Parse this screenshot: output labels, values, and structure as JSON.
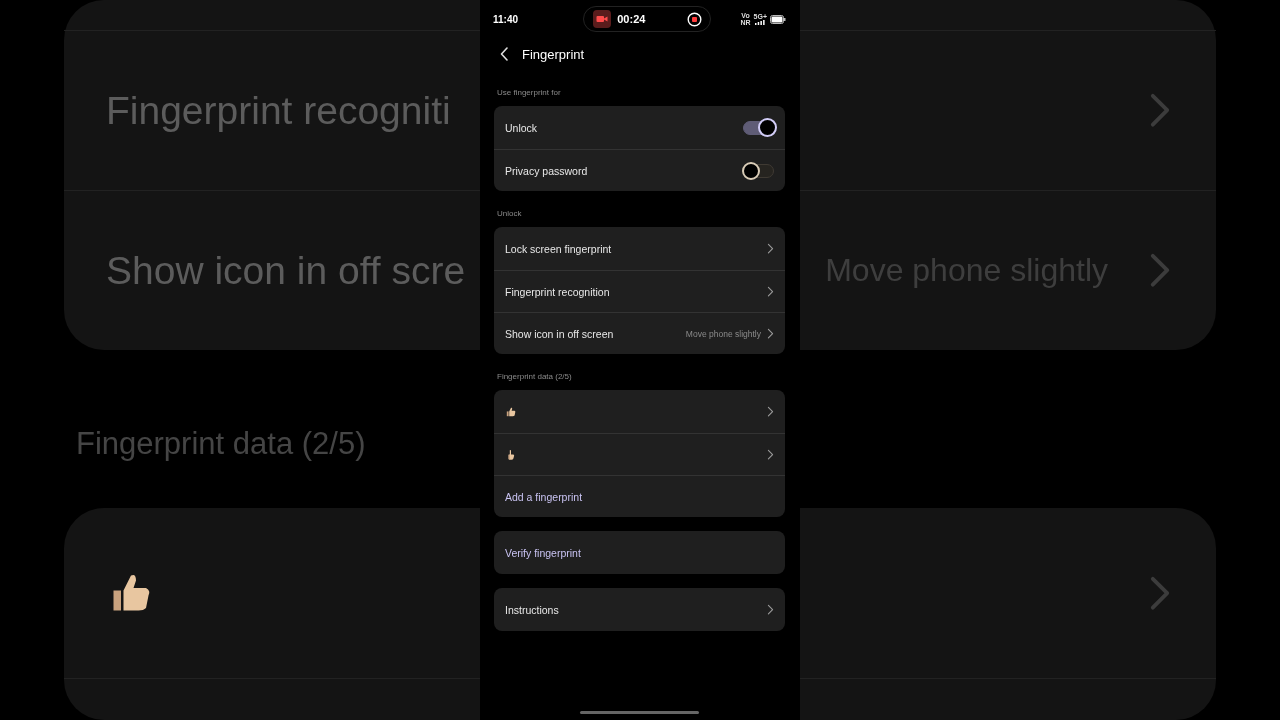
{
  "backdrop": {
    "sections": [
      {
        "rows": [
          {
            "label": "Fingerprint recogniti",
            "chevron": true
          },
          {
            "label": "Show icon in off scre",
            "value": "Move phone slightly",
            "chevron": true
          }
        ]
      },
      {
        "heading": "Fingerprint data (2/5)",
        "rows": [
          {
            "kind": "thumb",
            "chevron": true
          }
        ]
      }
    ]
  },
  "status_bar": {
    "time": "11:40",
    "recording_time": "00:24",
    "network_top": "Vo",
    "network_bottom": "NR",
    "network_type": "5G+"
  },
  "header": {
    "title": "Fingerprint"
  },
  "sections": [
    {
      "heading": "Use fingerprint for",
      "rows": [
        {
          "kind": "toggle",
          "label": "Unlock",
          "on": true
        },
        {
          "kind": "toggle",
          "label": "Privacy password",
          "on": false
        }
      ]
    },
    {
      "heading": "Unlock",
      "rows": [
        {
          "kind": "link",
          "label": "Lock screen fingerprint"
        },
        {
          "kind": "link",
          "label": "Fingerprint recognition"
        },
        {
          "kind": "link",
          "label": "Show icon in off screen",
          "value": "Move phone slightly"
        }
      ]
    },
    {
      "heading": "Fingerprint data (2/5)",
      "rows": [
        {
          "kind": "thumb"
        },
        {
          "kind": "index"
        },
        {
          "kind": "action",
          "label": "Add a fingerprint"
        }
      ]
    },
    {
      "rows": [
        {
          "kind": "action",
          "label": "Verify fingerprint"
        }
      ]
    },
    {
      "rows": [
        {
          "kind": "link",
          "label": "Instructions"
        }
      ]
    }
  ]
}
